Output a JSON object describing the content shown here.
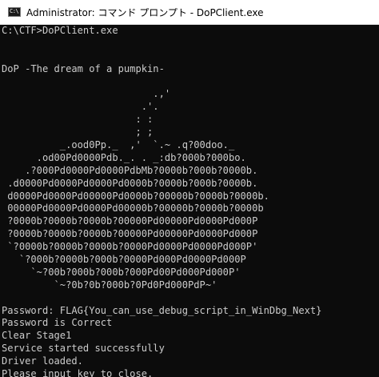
{
  "window": {
    "title": "Administrator: コマンド プロンプト - DoPClient.exe",
    "icon_label": "C:\\"
  },
  "console": {
    "lines": [
      "C:\\CTF>DoPClient.exe",
      "",
      "",
      "DoP -The dream of a pumpkin-",
      "",
      "                          .,'",
      "                        .'.",
      "                       : :",
      "                       ; ;",
      "          _.ood0Pp._  ,'  `.~ .q?00doo._",
      "      .od00Pd0000Pdb._. . _:db?000b?000bo.",
      "    .?000Pd0000Pd0000PdbMb?0000b?000b?0000b.",
      " .d0000Pd0000Pd0000Pd0000b?0000b?000b?0000b.",
      " d0000Pd0000Pd00000Pd0000b?00000b?0000b?0000b.",
      " 00000Pd0000Pd0000Pd00000b?00000b?0000b?0000b",
      " ?0000b?0000b?0000b?00000Pd00000Pd0000Pd000P",
      " ?0000b?0000b?0000b?00000Pd00000Pd0000Pd000P",
      " `?0000b?0000b?0000b?0000Pd0000Pd0000Pd000P'",
      "   `?000b?0000b?000b?0000Pd000Pd0000Pd000P",
      "     `~?00b?000b?000b?000Pd00Pd000Pd000P'",
      "         `~?0b?0b?000b?0Pd0Pd000PdP~'",
      "",
      "Password: FLAG{You_can_use_debug_script_in_WinDbg_Next}",
      "Password is Correct",
      "Clear Stage1",
      "Service started successfully",
      "Driver loaded.",
      "Please input key to close."
    ]
  }
}
